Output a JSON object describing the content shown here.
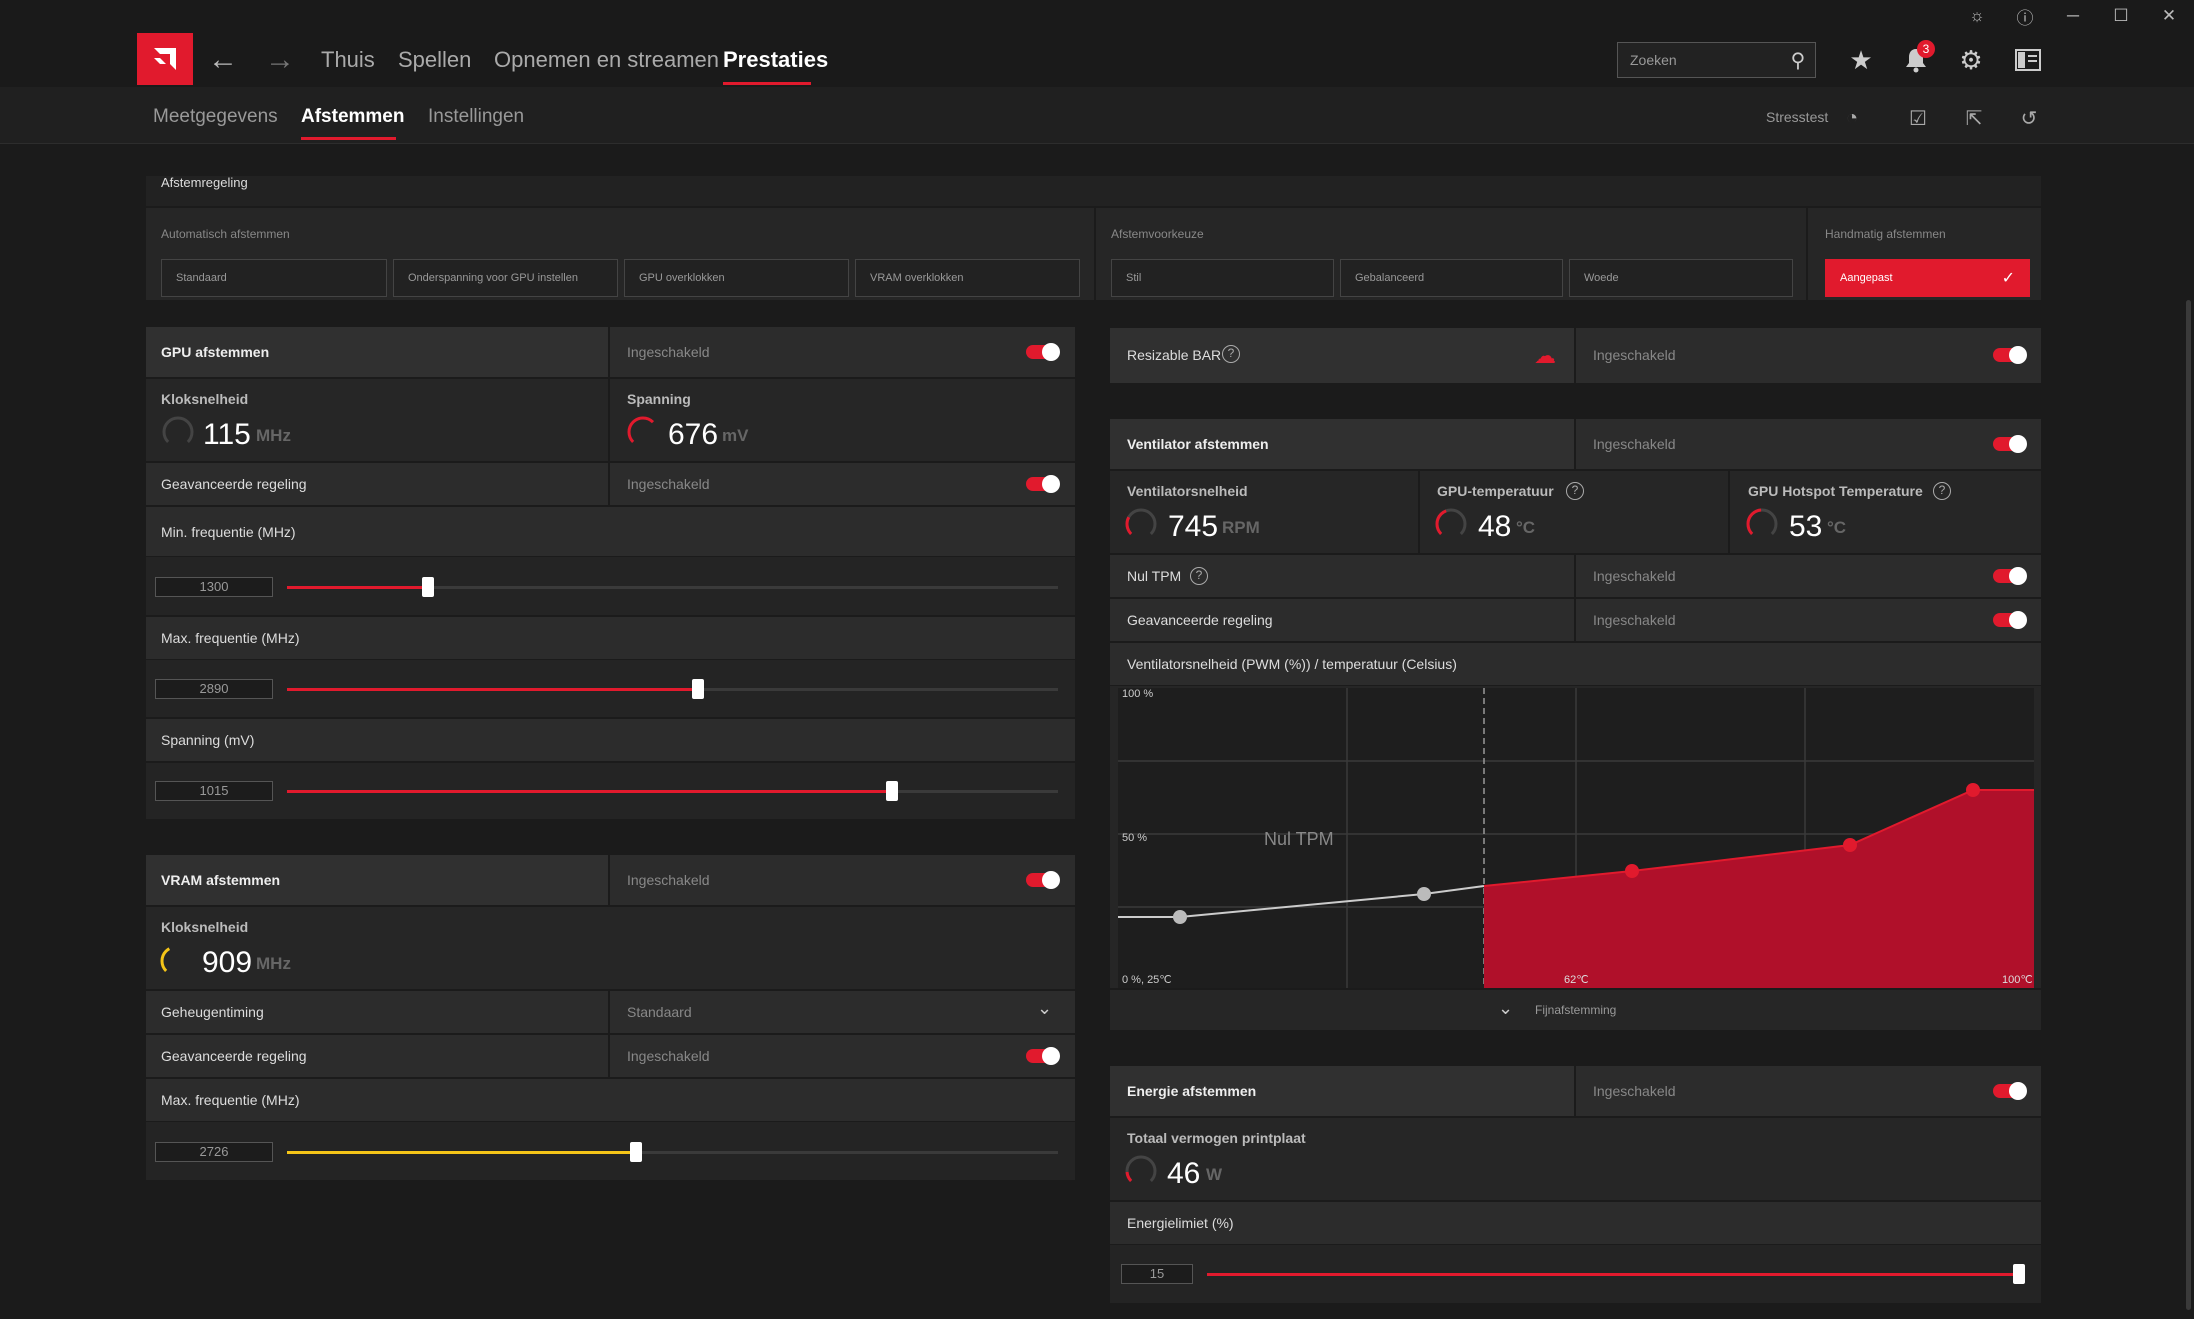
{
  "titlebar": {
    "controls": [
      "bug-icon",
      "help-icon",
      "minimize-icon",
      "maximize-icon",
      "close-icon"
    ]
  },
  "nav": {
    "tabs": [
      {
        "label": "Thuis"
      },
      {
        "label": "Spellen"
      },
      {
        "label": "Opnemen en streamen"
      },
      {
        "label": "Prestaties"
      }
    ],
    "active_tab": "Prestaties",
    "search_placeholder": "Zoeken",
    "notification_count": "3"
  },
  "subnav": {
    "tabs": [
      {
        "label": "Meetgegevens"
      },
      {
        "label": "Afstemmen"
      },
      {
        "label": "Instellingen"
      }
    ],
    "active_tab": "Afstemmen",
    "stress_test_label": "Stresstest"
  },
  "tuning_control": {
    "title": "Afstemregeling",
    "auto_label": "Automatisch afstemmen",
    "auto_buttons": [
      {
        "label": "Standaard"
      },
      {
        "label": "Onderspanning voor GPU instellen"
      },
      {
        "label": "GPU overklokken"
      },
      {
        "label": "VRAM overklokken"
      }
    ],
    "preference_label": "Afstemvoorkeuze",
    "preference_buttons": [
      {
        "label": "Stil"
      },
      {
        "label": "Gebalanceerd"
      },
      {
        "label": "Woede"
      }
    ],
    "manual_label": "Handmatig afstemmen",
    "manual_button": "Aangepast"
  },
  "gpu": {
    "title": "GPU afstemmen",
    "status": "Ingeschakeld",
    "enabled": true,
    "clock_label": "Kloksnelheid",
    "clock_value": "115",
    "clock_unit": "MHz",
    "voltage_label": "Spanning",
    "voltage_value": "676",
    "voltage_unit": "mV",
    "advanced_label": "Geavanceerde regeling",
    "advanced_status": "Ingeschakeld",
    "min_freq_label": "Min. frequentie (MHz)",
    "min_freq_value": "1300",
    "min_freq_fraction": 0.183,
    "max_freq_label": "Max. frequentie (MHz)",
    "max_freq_value": "2890",
    "max_freq_fraction": 0.533,
    "voltage_slider_label": "Spanning (mV)",
    "voltage_slider_value": "1015",
    "voltage_slider_fraction": 0.785
  },
  "vram": {
    "title": "VRAM afstemmen",
    "status": "Ingeschakeld",
    "clock_label": "Kloksnelheid",
    "clock_value": "909",
    "clock_unit": "MHz",
    "timing_label": "Geheugentiming",
    "timing_value": "Standaard",
    "advanced_label": "Geavanceerde regeling",
    "advanced_status": "Ingeschakeld",
    "max_freq_label": "Max. frequentie (MHz)",
    "max_freq_value": "2726",
    "max_freq_fraction": 0.453,
    "accent": "#f5c518"
  },
  "rebar": {
    "label": "Resizable BAR",
    "status": "Ingeschakeld"
  },
  "fan": {
    "title": "Ventilator afstemmen",
    "status": "Ingeschakeld",
    "speed_label": "Ventilatorsnelheid",
    "speed_value": "745",
    "speed_unit": "RPM",
    "temp_label": "GPU-temperatuur",
    "temp_value": "48",
    "temp_unit": "°C",
    "hotspot_label": "GPU Hotspot Temperature",
    "hotspot_value": "53",
    "hotspot_unit": "°C",
    "zero_rpm_label": "Nul TPM",
    "zero_rpm_status": "Ingeschakeld",
    "advanced_label": "Geavanceerde regeling",
    "advanced_status": "Ingeschakeld",
    "curve_title": "Ventilatorsnelheid (PWM (%)) / temperatuur (Celsius)",
    "curve_y_top": "100 %",
    "curve_y_mid": "50 %",
    "curve_origin": "0 %, 25℃",
    "curve_x_mid": "62℃",
    "curve_x_max": "100℃",
    "curve_zone_label": "Nul TPM",
    "fine_tune_label": "Fijnafstemming"
  },
  "power": {
    "title": "Energie afstemmen",
    "status": "Ingeschakeld",
    "board_power_label": "Totaal vermogen printplaat",
    "board_power_value": "46",
    "board_power_unit": "W",
    "limit_label": "Energielimiet (%)",
    "limit_value": "15",
    "limit_fraction": 1.0
  },
  "colors": {
    "accent": "#e11a2d",
    "vram_accent": "#f5c518"
  }
}
